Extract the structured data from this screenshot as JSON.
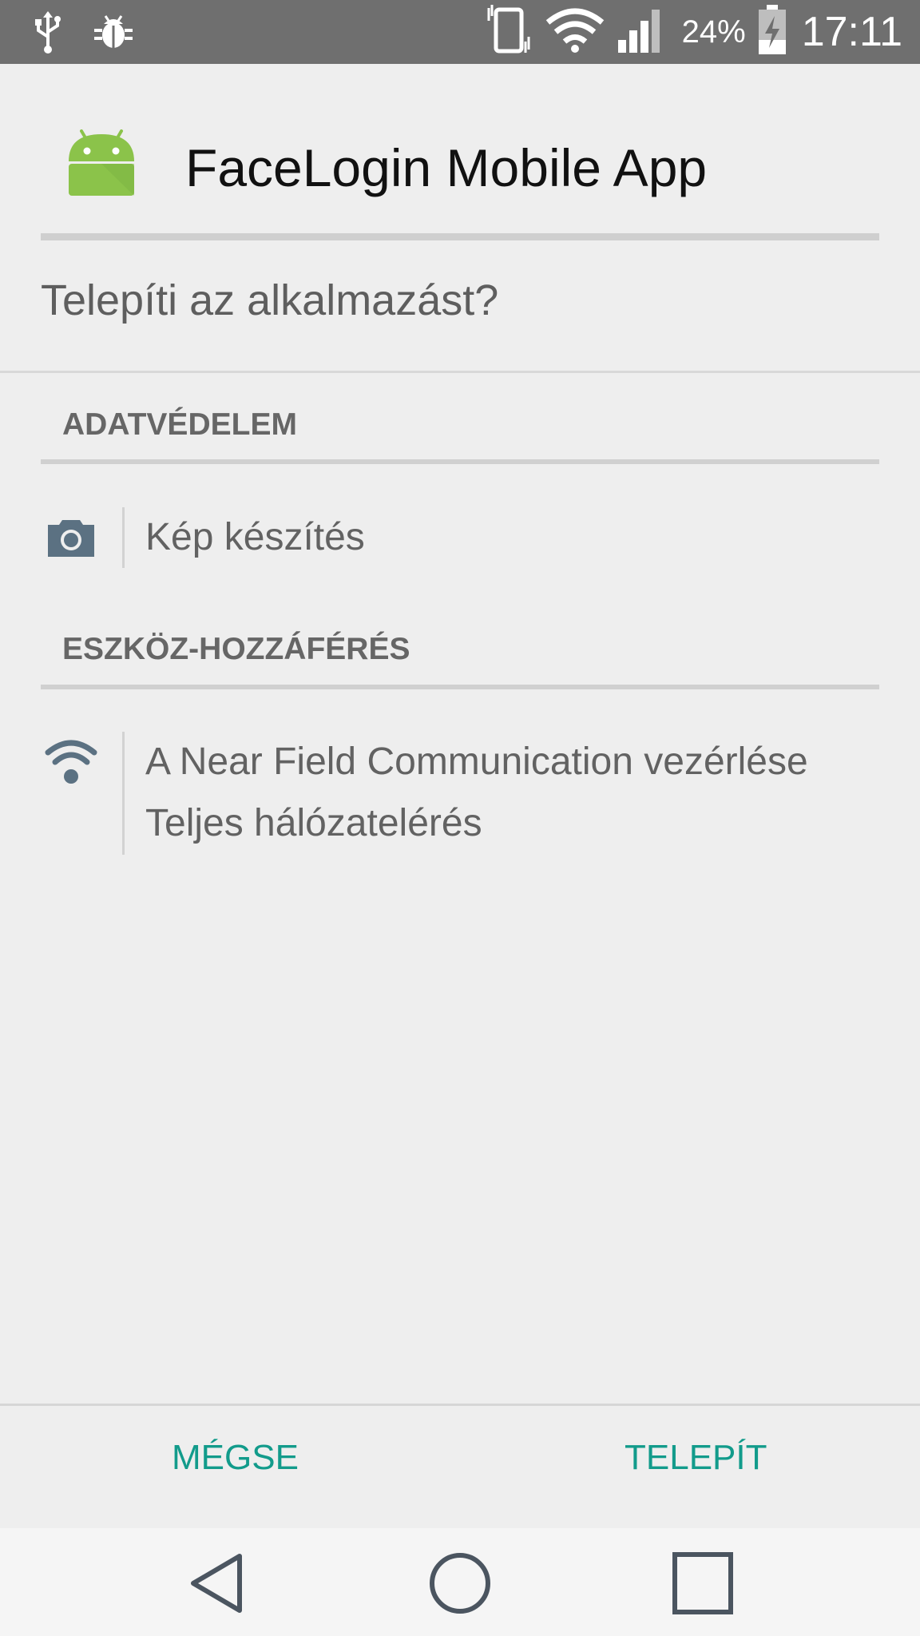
{
  "status_bar": {
    "battery_percent": "24%",
    "time": "17:11",
    "left_icons": [
      "usb-icon",
      "bug-icon"
    ],
    "right_icons": [
      "vibrate-icon",
      "wifi-icon",
      "signal-icon",
      "battery-charging-icon"
    ]
  },
  "header": {
    "app_name": "FaceLogin Mobile App",
    "app_icon": "android-icon"
  },
  "install_question": "Telepíti az alkalmazást?",
  "sections": [
    {
      "title": "ADATVÉDELEM",
      "icon": "camera-icon",
      "permissions": [
        "Kép készítés"
      ]
    },
    {
      "title": "ESZKÖZ-HOZZÁFÉRÉS",
      "icon": "wifi-icon",
      "permissions": [
        "A Near Field Communication vezérlése",
        "Teljes hálózatelérés"
      ]
    }
  ],
  "buttons": {
    "cancel": "MÉGSE",
    "install": "TELEPÍT"
  },
  "colors": {
    "accent": "#129b8b",
    "status_bar": "#6f6f6f",
    "background": "#eeeeee",
    "icon_gray": "#5b7182",
    "android_green": "#8bc34a"
  },
  "nav_bar": [
    "back-icon",
    "home-icon",
    "recents-icon"
  ]
}
